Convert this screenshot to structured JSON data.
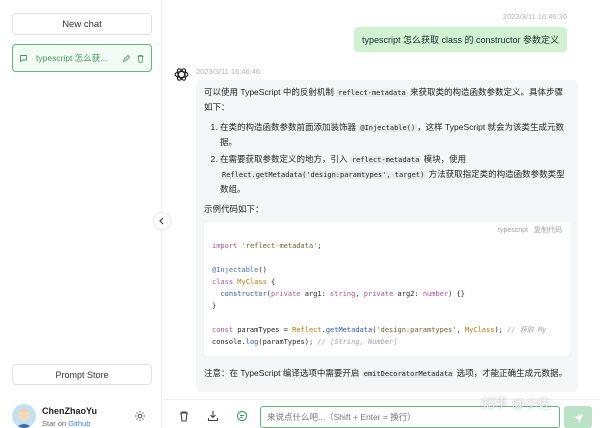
{
  "sidebar": {
    "new_chat_label": "New chat",
    "chats": [
      {
        "title": "typescript 怎么获..."
      }
    ],
    "prompt_store_label": "Prompt Store",
    "user": {
      "name": "ChenZhaoYu",
      "sub_prefix": "Star on ",
      "sub_link": "Github"
    }
  },
  "conversation": {
    "user_message": {
      "timestamp": "2023/3/11 16:46:36",
      "text": "typescript 怎么获取 class 的 constructor 参数定义"
    },
    "ai_message": {
      "timestamp": "2023/3/11 16:46:46",
      "intro_1": "可以使用 TypeScript 中的反射机制 ",
      "intro_code": "reflect-metadata",
      "intro_2": " 来获取类的构造函数参数定义。具体步骤如下：",
      "step1_a": "在类的构造函数参数前面添加装饰器 ",
      "step1_code": "@Injectable()",
      "step1_b": "，这样 TypeScript 就会为该类生成元数据。",
      "step2_a": "在需要获取参数定义的地方，引入 ",
      "step2_code1": "reflect-metadata",
      "step2_b": " 模块，使用 ",
      "step2_code2": "Reflect.getMetadata('design:paramtypes', target)",
      "step2_c": " 方法获取指定类的构造函数参数类型数组。",
      "example_label": "示例代码如下：",
      "code_lang": "typescript",
      "code_copy": "复制代码",
      "code": {
        "l1_kw": "import",
        "l1_str": "'reflect-metadata'",
        "l1_end": ";",
        "l3_dec": "@Injectable",
        "l3_end": "()",
        "l4_kw": "class",
        "l4_cls": "MyClass",
        "l4_end": " {",
        "l5_fn": "constructor",
        "l5_a": "(",
        "l5_kw1": "private",
        "l5_b": " arg1: ",
        "l5_t1": "string",
        "l5_c": ", ",
        "l5_kw2": "private",
        "l5_d": " arg2: ",
        "l5_t2": "number",
        "l5_e": ") {}",
        "l6": "}",
        "l8_kw": "const",
        "l8_a": " paramTypes = ",
        "l8_obj": "Reflect",
        "l8_dot": ".",
        "l8_fn": "getMetadata",
        "l8_b": "(",
        "l8_str": "'design:paramtypes'",
        "l8_c": ", ",
        "l8_cls": "MyClass",
        "l8_d": ");",
        "l8_cmt": "// 获取 My",
        "l9_a": "console",
        "l9_b": ".",
        "l9_fn": "log",
        "l9_c": "(paramTypes);",
        "l9_cmt": "// [String, Number]"
      },
      "note_1": "注意：在 TypeScript 编译选项中需要开启 ",
      "note_code": "emitDecoratorMetadata",
      "note_2": " 选项，才能正确生成元数据。"
    }
  },
  "composer": {
    "placeholder": "来说点什么吧...（Shift + Enter = 换行）"
  },
  "watermark": "知乎 @小佐",
  "colors": {
    "accent": "#5fb878",
    "user_bubble": "#d1f2d0",
    "ai_bubble": "#f5f6f8"
  },
  "icons": [
    "chat-bubble-icon",
    "edit-icon",
    "trash-icon",
    "settings-icon",
    "chevron-left-icon",
    "openai-icon",
    "download-icon",
    "context-icon",
    "send-icon"
  ]
}
